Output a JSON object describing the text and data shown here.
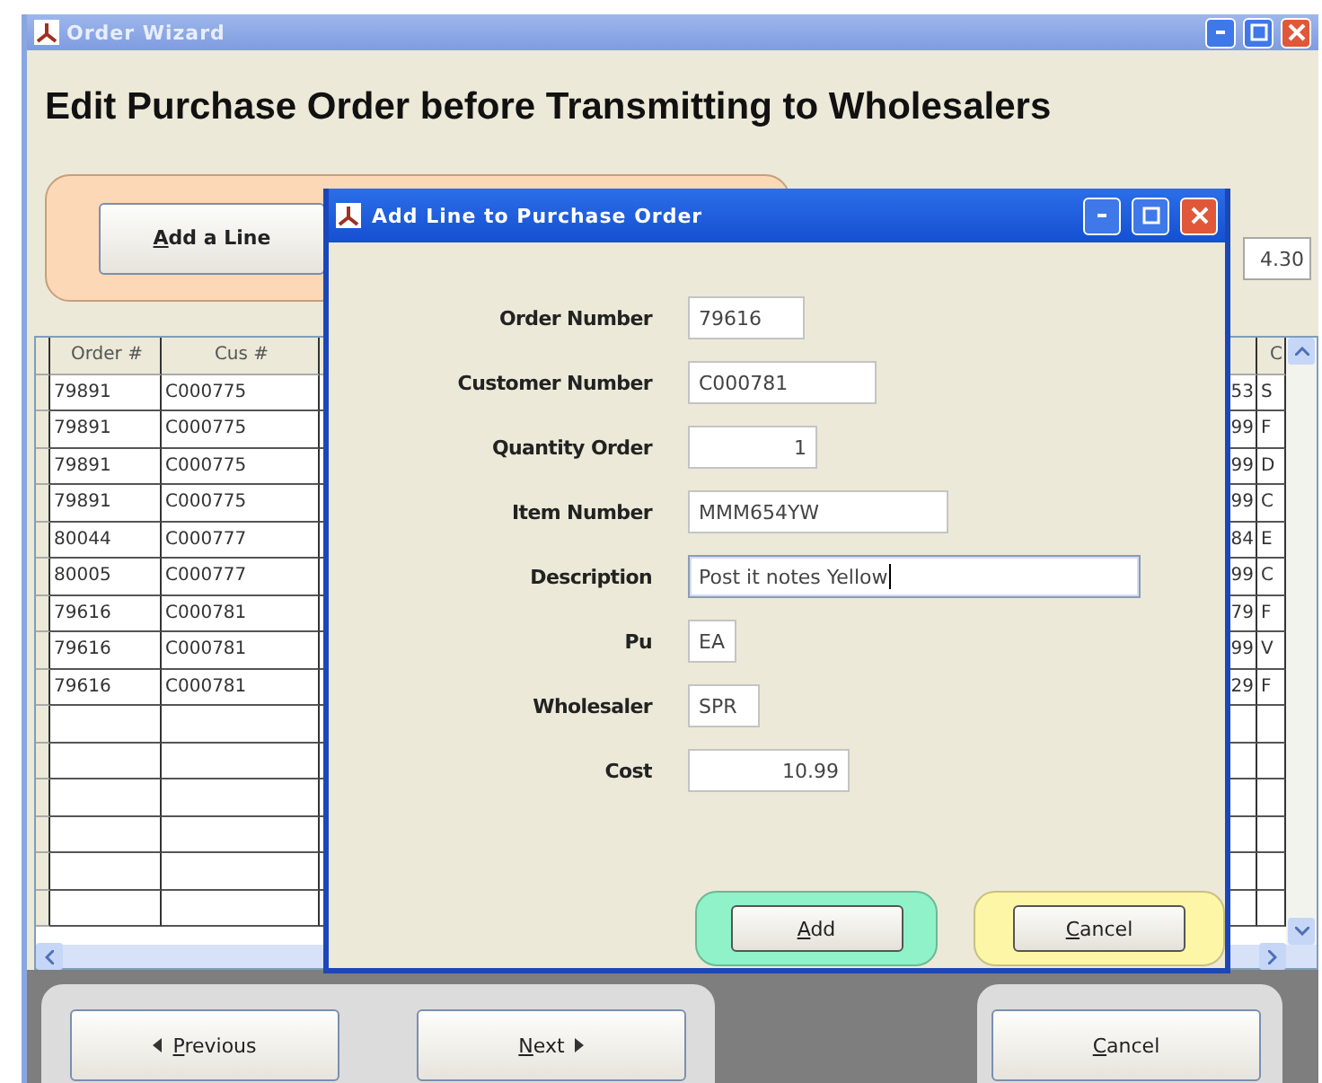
{
  "window": {
    "title": "Order Wizard"
  },
  "heading": "Edit Purchase Order before Transmitting to Wholesalers",
  "add_line_button": "Add a Line",
  "total_field": "4.30",
  "table": {
    "headers": [
      "Order #",
      "Cus #"
    ],
    "column_5_header": "C",
    "rows": [
      {
        "order": "79891",
        "customer": "C000775",
        "column_4": "53",
        "column_5": "S"
      },
      {
        "order": "79891",
        "customer": "C000775",
        "column_4": "99",
        "column_5": "F"
      },
      {
        "order": "79891",
        "customer": "C000775",
        "column_4": "99",
        "column_5": "D"
      },
      {
        "order": "79891",
        "customer": "C000775",
        "column_4": "99",
        "column_5": "C"
      },
      {
        "order": "80044",
        "customer": "C000777",
        "column_4": "84",
        "column_5": "E"
      },
      {
        "order": "80005",
        "customer": "C000777",
        "column_4": "99",
        "column_5": "C"
      },
      {
        "order": "79616",
        "customer": "C000781",
        "column_4": "79",
        "column_5": "F"
      },
      {
        "order": "79616",
        "customer": "C000781",
        "column_4": "99",
        "column_5": "V"
      },
      {
        "order": "79616",
        "customer": "C000781",
        "column_4": "29",
        "column_5": "F"
      }
    ]
  },
  "wizard_buttons": [
    {
      "label": "Previous",
      "kind": "back"
    },
    {
      "label": "Next",
      "kind": "forward"
    },
    {
      "label": "Cancel",
      "kind": "plain"
    }
  ],
  "dialog": {
    "title": "Add Line to Purchase Order",
    "fields": [
      {
        "label": "Order Number",
        "value": "79616",
        "kind": "text",
        "focused": false
      },
      {
        "label": "Customer Number",
        "value": "C000781",
        "kind": "text",
        "focused": false
      },
      {
        "label": "Quantity Order",
        "value": "1",
        "kind": "number",
        "focused": false
      },
      {
        "label": "Item Number",
        "value": "MMM654YW",
        "kind": "text",
        "focused": false
      },
      {
        "label": "Description",
        "value": "Post it notes Yellow",
        "kind": "text",
        "focused": true
      },
      {
        "label": "Pu",
        "value": "EA",
        "kind": "text",
        "focused": false
      },
      {
        "label": "Wholesaler",
        "value": "SPR",
        "kind": "text",
        "focused": false
      },
      {
        "label": "Cost",
        "value": "10.99",
        "kind": "number",
        "focused": false
      }
    ],
    "buttons": [
      {
        "label": "Add",
        "kind": "confirm"
      },
      {
        "label": "Cancel",
        "kind": "cancel"
      }
    ]
  }
}
